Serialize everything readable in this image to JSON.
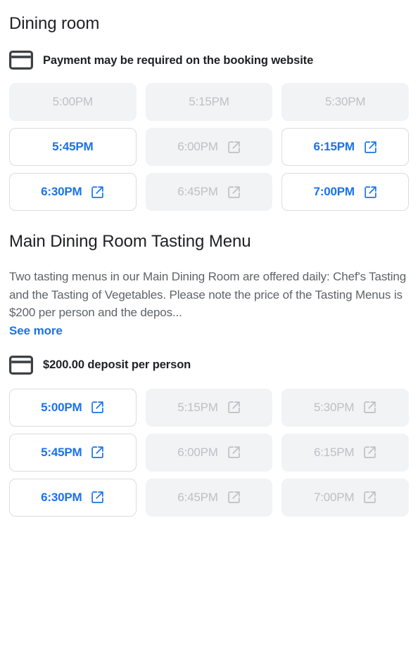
{
  "sections": [
    {
      "title": "Dining room",
      "payment_note": {
        "icon": "credit-card-icon",
        "text": "Payment may be required on the booking website"
      },
      "slots": [
        {
          "time": "5:00PM",
          "state": "disabled",
          "external_link": false
        },
        {
          "time": "5:15PM",
          "state": "disabled",
          "external_link": false
        },
        {
          "time": "5:30PM",
          "state": "disabled",
          "external_link": false
        },
        {
          "time": "5:45PM",
          "state": "enabled",
          "external_link": false
        },
        {
          "time": "6:00PM",
          "state": "disabled",
          "external_link": true
        },
        {
          "time": "6:15PM",
          "state": "enabled",
          "external_link": true
        },
        {
          "time": "6:30PM",
          "state": "enabled",
          "external_link": true
        },
        {
          "time": "6:45PM",
          "state": "disabled",
          "external_link": true
        },
        {
          "time": "7:00PM",
          "state": "enabled",
          "external_link": true
        }
      ]
    },
    {
      "title": "Main Dining Room Tasting Menu",
      "description": "Two tasting menus in our Main Dining Room are offered daily: Chef's Tasting and the Tasting of Vegetables. Please note the price of the Tasting Menus is $200 per person and the depos...",
      "see_more_label": "See more",
      "payment_note": {
        "icon": "credit-card-icon",
        "text": "$200.00 deposit per person"
      },
      "slots": [
        {
          "time": "5:00PM",
          "state": "enabled",
          "external_link": true
        },
        {
          "time": "5:15PM",
          "state": "disabled",
          "external_link": true
        },
        {
          "time": "5:30PM",
          "state": "disabled",
          "external_link": true
        },
        {
          "time": "5:45PM",
          "state": "enabled",
          "external_link": true
        },
        {
          "time": "6:00PM",
          "state": "disabled",
          "external_link": true
        },
        {
          "time": "6:15PM",
          "state": "disabled",
          "external_link": true
        },
        {
          "time": "6:30PM",
          "state": "enabled",
          "external_link": true
        },
        {
          "time": "6:45PM",
          "state": "disabled",
          "external_link": true
        },
        {
          "time": "7:00PM",
          "state": "disabled",
          "external_link": true
        }
      ]
    }
  ],
  "colors": {
    "accent_blue": "#1a73e8",
    "disabled_fill": "#f1f3f4",
    "disabled_text": "#bdc1c6",
    "border": "#dadce0",
    "text_primary": "#202124",
    "text_secondary": "#5f6368"
  }
}
